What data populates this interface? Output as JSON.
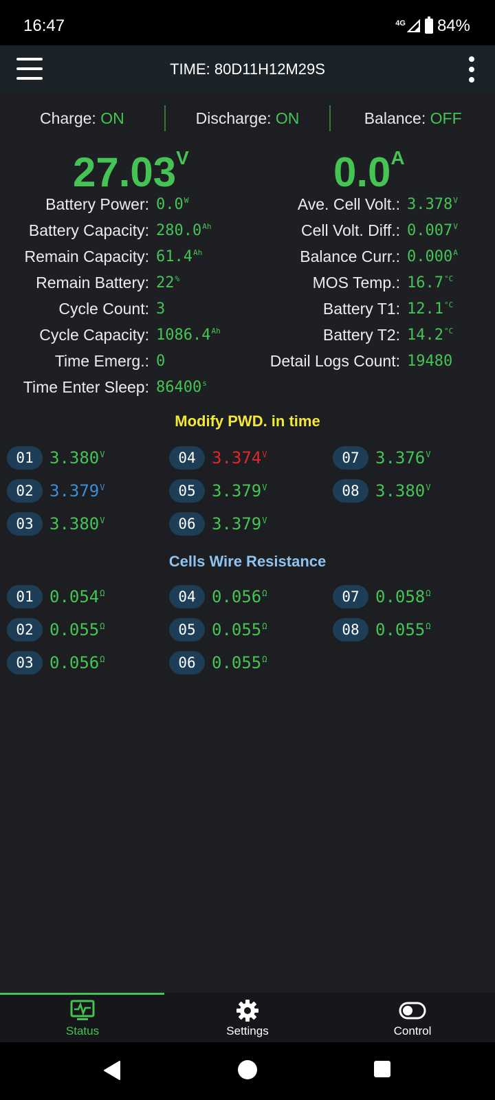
{
  "status_bar": {
    "time": "16:47",
    "network": "4G",
    "battery": "84%"
  },
  "app_bar": {
    "title": "TIME: 80D11H12M29S"
  },
  "switches": [
    {
      "label": "Charge:",
      "value": "ON"
    },
    {
      "label": "Discharge:",
      "value": "ON"
    },
    {
      "label": "Balance:",
      "value": "OFF"
    }
  ],
  "main": {
    "voltage": {
      "value": "27.03",
      "unit": "V"
    },
    "current": {
      "value": "0.0",
      "unit": "A"
    }
  },
  "stats_left": [
    {
      "label": "Battery Power:",
      "value": "0.0",
      "unit": "W"
    },
    {
      "label": "Battery Capacity:",
      "value": "280.0",
      "unit": "Ah"
    },
    {
      "label": "Remain Capacity:",
      "value": "61.4",
      "unit": "Ah"
    },
    {
      "label": "Remain Battery:",
      "value": "22",
      "unit": "%"
    },
    {
      "label": "Cycle Count:",
      "value": "3",
      "unit": ""
    },
    {
      "label": "Cycle Capacity:",
      "value": "1086.4",
      "unit": "Ah"
    },
    {
      "label": "Time Emerg.:",
      "value": "0",
      "unit": ""
    },
    {
      "label": "Time Enter Sleep:",
      "value": "86400",
      "unit": "s"
    }
  ],
  "stats_right": [
    {
      "label": "Ave. Cell Volt.:",
      "value": "3.378",
      "unit": "V"
    },
    {
      "label": "Cell Volt. Diff.:",
      "value": "0.007",
      "unit": "V"
    },
    {
      "label": "Balance Curr.:",
      "value": "0.000",
      "unit": "A"
    },
    {
      "label": "MOS Temp.:",
      "value": "16.7",
      "unit": "°C"
    },
    {
      "label": "Battery T1:",
      "value": "12.1",
      "unit": "°C"
    },
    {
      "label": "Battery T2:",
      "value": "14.2",
      "unit": "°C"
    },
    {
      "label": "Detail Logs Count:",
      "value": "19480",
      "unit": ""
    }
  ],
  "cell_voltages": {
    "title": "Modify PWD. in time",
    "title_color": "#f2e83a",
    "cells": [
      {
        "id": "01",
        "value": "3.380",
        "unit": "V",
        "color": "#45c455"
      },
      {
        "id": "02",
        "value": "3.379",
        "unit": "V",
        "color": "#3a8fd8"
      },
      {
        "id": "03",
        "value": "3.380",
        "unit": "V",
        "color": "#45c455"
      },
      {
        "id": "04",
        "value": "3.374",
        "unit": "V",
        "color": "#e02828"
      },
      {
        "id": "05",
        "value": "3.379",
        "unit": "V",
        "color": "#45c455"
      },
      {
        "id": "06",
        "value": "3.379",
        "unit": "V",
        "color": "#45c455"
      },
      {
        "id": "07",
        "value": "3.376",
        "unit": "V",
        "color": "#45c455"
      },
      {
        "id": "08",
        "value": "3.380",
        "unit": "V",
        "color": "#45c455"
      }
    ]
  },
  "wire_resistance": {
    "title": "Cells Wire Resistance",
    "title_color": "#8fc3ef",
    "cells": [
      {
        "id": "01",
        "value": "0.054",
        "unit": "Ω"
      },
      {
        "id": "02",
        "value": "0.055",
        "unit": "Ω"
      },
      {
        "id": "03",
        "value": "0.056",
        "unit": "Ω"
      },
      {
        "id": "04",
        "value": "0.056",
        "unit": "Ω"
      },
      {
        "id": "05",
        "value": "0.055",
        "unit": "Ω"
      },
      {
        "id": "06",
        "value": "0.055",
        "unit": "Ω"
      },
      {
        "id": "07",
        "value": "0.058",
        "unit": "Ω"
      },
      {
        "id": "08",
        "value": "0.055",
        "unit": "Ω"
      }
    ]
  },
  "bottom_nav": [
    {
      "label": "Status",
      "icon": "monitor-icon",
      "active": true
    },
    {
      "label": "Settings",
      "icon": "gear-icon",
      "active": false
    },
    {
      "label": "Control",
      "icon": "toggle-icon",
      "active": false
    }
  ],
  "colors": {
    "accent_green": "#45c455",
    "pill_bg": "#1d3e56",
    "app_bar": "#1b2228"
  }
}
